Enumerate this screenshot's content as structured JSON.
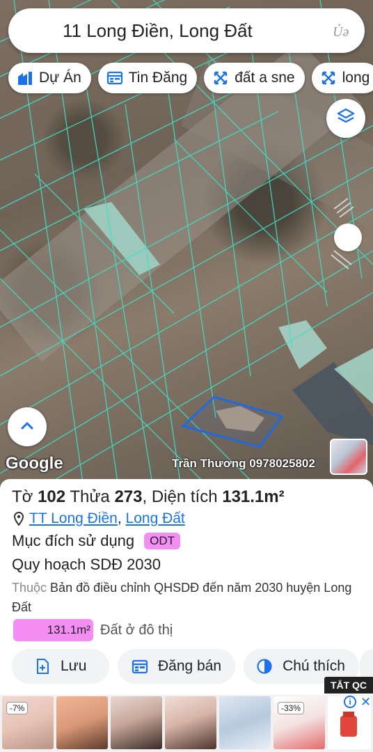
{
  "search": {
    "query": "11 Long Điền, Long Đất"
  },
  "chips": [
    {
      "label": "Dự Án",
      "icon": "project-icon"
    },
    {
      "label": "Tin Đăng",
      "icon": "listing-icon"
    },
    {
      "label": "đất a sne",
      "icon": "map-pattern-icon"
    },
    {
      "label": "long",
      "icon": "map-pattern-icon"
    }
  ],
  "map": {
    "logo": "Google",
    "watermark": "Trần Thương 0978025802"
  },
  "parcel": {
    "sheet_label": "Tờ",
    "sheet": "102",
    "plot_label": "Thửa",
    "plot": "273",
    "area_label": ", Diện tích",
    "area": "131.1m²",
    "location_town": "TT Long Điền",
    "location_district": "Long Đất",
    "purpose_label": "Mục đích sử dụng",
    "purpose_code": "ODT",
    "plan_title": "Quy hoạch SDĐ 2030",
    "belongs_label": "Thuộc",
    "belongs_text": "Bản đồ điều chỉnh QHSDĐ đến năm 2030 huyện Long Đất",
    "area_bar_value": "131.1m²",
    "area_bar_fraction": 1.0,
    "area_bar_desc": "Đất ở đô thị"
  },
  "actions": [
    {
      "label": "Lưu",
      "icon": "save-icon"
    },
    {
      "label": "Đăng bán",
      "icon": "calendar-icon"
    },
    {
      "label": "Chú thích",
      "icon": "legend-icon"
    }
  ],
  "ads": {
    "close_label": "TẮT QC",
    "items": [
      {
        "badge": "-7%"
      },
      {
        "badge": ""
      },
      {
        "badge": ""
      },
      {
        "badge": ""
      },
      {
        "badge": ""
      },
      {
        "badge": "-33%"
      }
    ]
  },
  "colors": {
    "accent": "#1a73e8",
    "badge_pink": "#f48ef5",
    "parcel_line": "#3ee0c8",
    "selected_parcel": "#1e6be0"
  }
}
